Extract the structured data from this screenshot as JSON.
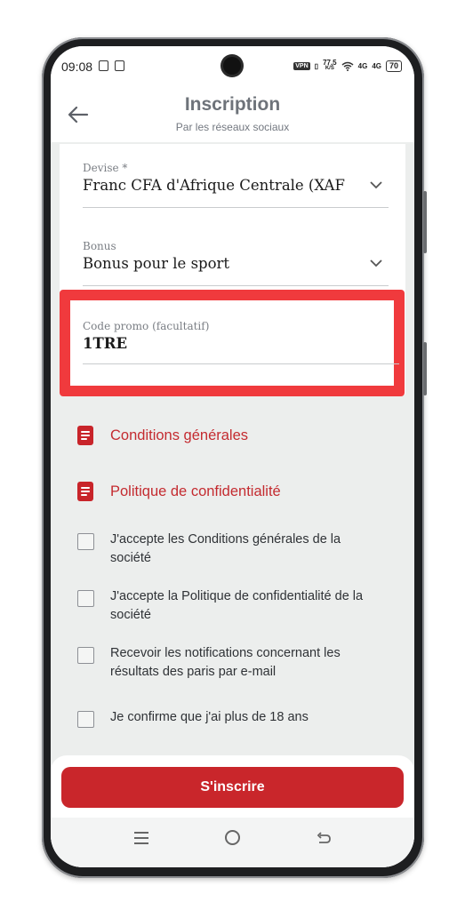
{
  "status_bar": {
    "time": "09:08",
    "network_speed_value": "77,5",
    "network_speed_unit": "K/S",
    "vpn": "VPN",
    "signal_1": "4G",
    "signal_2": "4G",
    "battery": "70"
  },
  "header": {
    "title": "Inscription",
    "subtitle": "Par les réseaux sociaux"
  },
  "form": {
    "currency": {
      "label": "Devise *",
      "value": "Franc CFA d'Afrique Centrale (XAF"
    },
    "bonus": {
      "label": "Bonus",
      "value": "Bonus pour le sport"
    },
    "promo": {
      "label": "Code promo (facultatif)",
      "value": "1TRE"
    }
  },
  "links": [
    {
      "label": "Conditions générales",
      "icon": "document-icon"
    },
    {
      "label": "Politique de confidentialité",
      "icon": "document-icon"
    }
  ],
  "checkboxes": [
    {
      "label": "J'accepte les Conditions générales de la société",
      "checked": false
    },
    {
      "label": "J'accepte la Politique de confidentialité de la société",
      "checked": false
    },
    {
      "label": "Recevoir les notifications concernant les résultats des paris par e-mail",
      "checked": false
    },
    {
      "label": "Je confirme que j'ai plus de 18 ans",
      "checked": false
    }
  ],
  "submit": {
    "label": "S'inscrire"
  },
  "colors": {
    "accent": "#c9262b",
    "highlight_border": "#f03a3d",
    "background": "#eceeed"
  }
}
